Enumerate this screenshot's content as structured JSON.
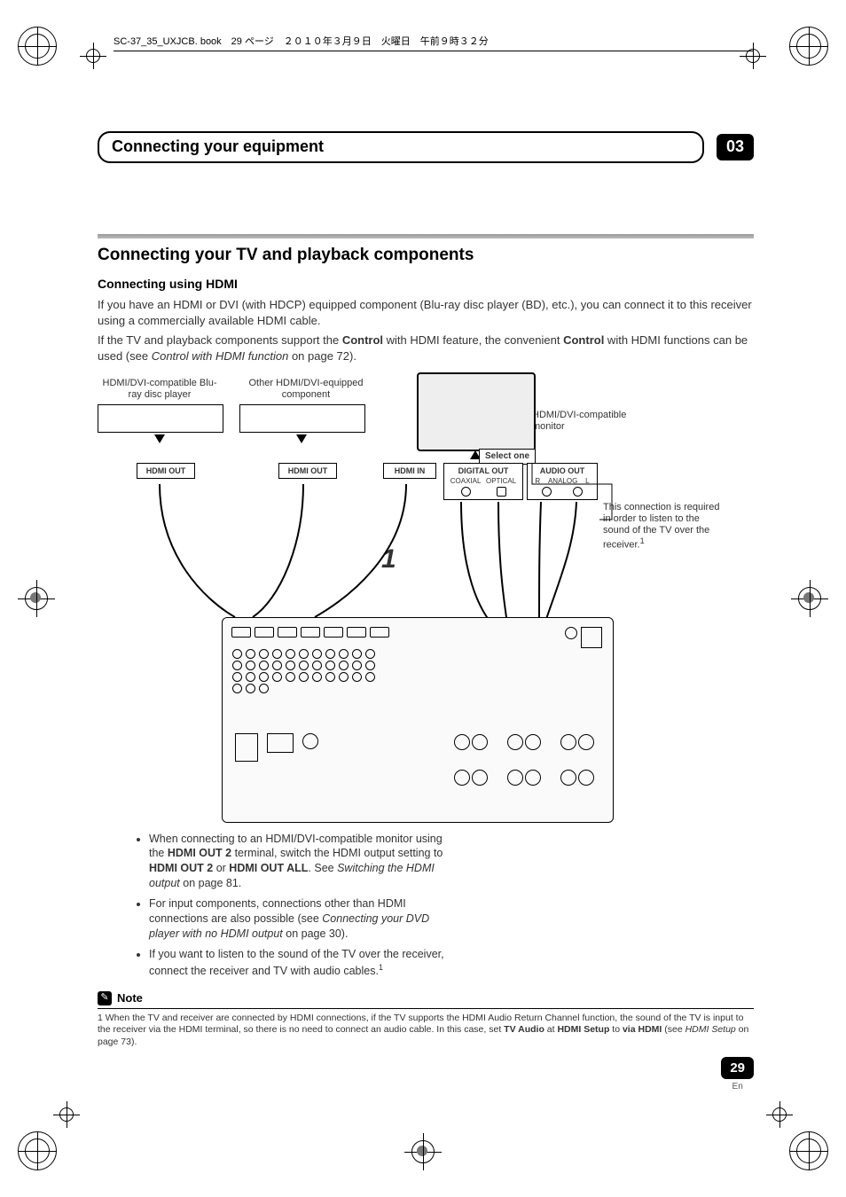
{
  "book_header": "SC-37_35_UXJCB. book　29 ページ　２０１０年３月９日　火曜日　午前９時３２分",
  "chapter": {
    "title": "Connecting your equipment",
    "number": "03"
  },
  "section_title": "Connecting your TV and playback components",
  "subsection_title": "Connecting using HDMI",
  "para1": "If you have an HDMI or DVI (with HDCP) equipped component (Blu-ray disc player (BD), etc.), you can connect it to this receiver using a commercially available HDMI cable.",
  "para2_pre": "If the TV and playback components support the ",
  "para2_b1": "Control",
  "para2_mid": " with HDMI feature, the convenient ",
  "para2_b2": "Control",
  "para2_mid2": " with HDMI functions can be used (see ",
  "para2_em": "Control with HDMI function",
  "para2_tail": " on page 72).",
  "diagram": {
    "bluray_label": "HDMI/DVI-compatible Blu-ray disc player",
    "other_label": "Other HDMI/DVI-equipped component",
    "monitor_label": "HDMI/DVI-compatible monitor",
    "select_one": "Select one",
    "hdmi_out": "HDMI OUT",
    "hdmi_in": "HDMI IN",
    "digital_out": "DIGITAL OUT",
    "coaxial": "COAXIAL",
    "optical": "OPTICAL",
    "audio_out": "AUDIO OUT",
    "analog": "ANALOG",
    "r": "R",
    "l": "L",
    "conn_note": "This connection is required in order to listen to the sound of the TV over the receiver.",
    "conn_note_sup": "1",
    "big_one": "1"
  },
  "bullets": {
    "b1_pre": "When connecting to an HDMI/DVI-compatible monitor using the ",
    "b1_s1": "HDMI OUT 2",
    "b1_mid": " terminal, switch the HDMI output setting to ",
    "b1_s2": "HDMI OUT 2",
    "b1_mid2": " or ",
    "b1_s3": "HDMI OUT ALL",
    "b1_mid3": ". See ",
    "b1_em": "Switching the HDMI output",
    "b1_tail": " on page 81.",
    "b2_pre": "For input components, connections other than HDMI connections are also possible (see ",
    "b2_em": "Connecting your DVD player with no HDMI output",
    "b2_tail": " on page 30).",
    "b3_pre": "If you want to listen to the sound of the TV over the receiver, connect the receiver and TV with audio cables.",
    "b3_sup": "1"
  },
  "note_label": "Note",
  "footnote_pre": "1 When the TV and receiver are connected by HDMI connections, if the TV supports the HDMI Audio Return Channel function, the sound of the TV is input to the receiver via the HDMI terminal, so there is no need to connect an audio cable. In this case, set ",
  "footnote_s1": "TV Audio",
  "footnote_mid": " at ",
  "footnote_s2": "HDMI Setup",
  "footnote_mid2": " to ",
  "footnote_s3": "via HDMI",
  "footnote_mid3": " (see ",
  "footnote_em": "HDMI Setup",
  "footnote_tail": " on page 73).",
  "page_number": "29",
  "page_lang": "En"
}
